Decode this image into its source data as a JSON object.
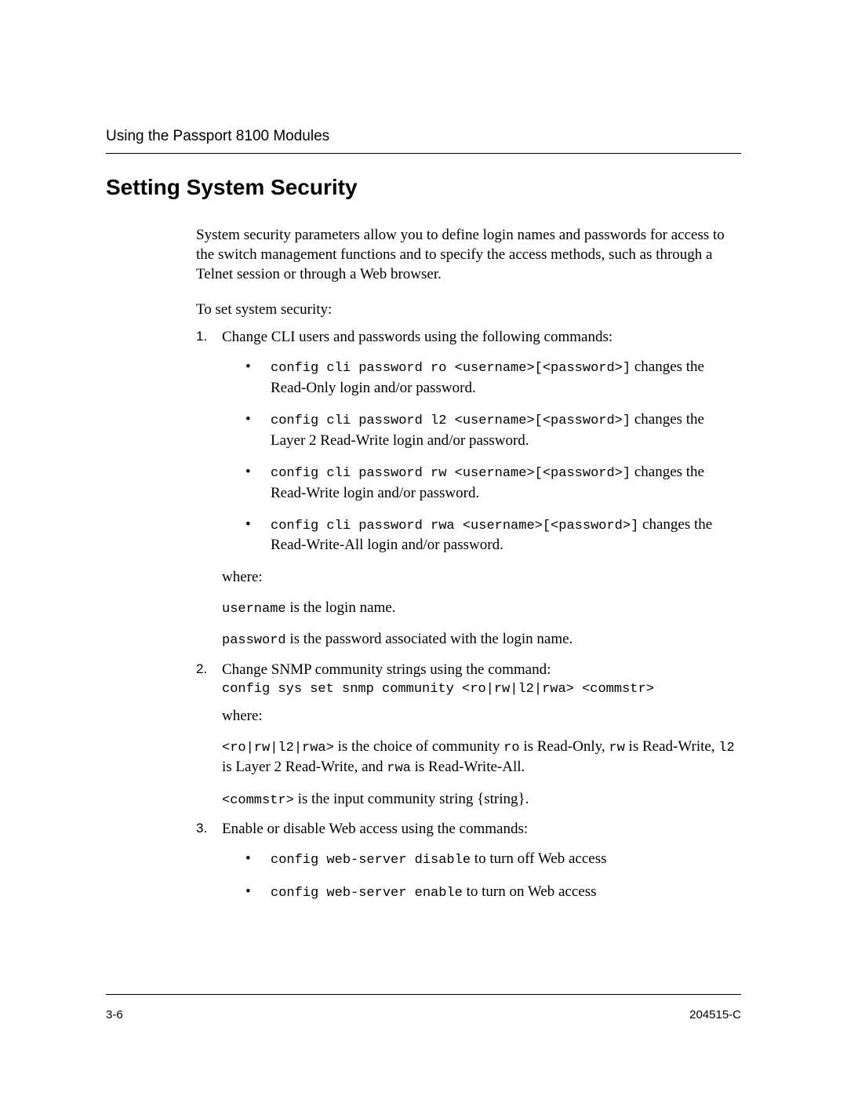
{
  "header": {
    "running_title": "Using the Passport 8100 Modules"
  },
  "title": "Setting System Security",
  "intro": "System security parameters allow you to define login names and passwords for access to the switch management functions and to specify the access methods, such as through a Telnet session or through a Web browser.",
  "lead": "To set system security:",
  "steps": [
    {
      "title": "Change CLI users and passwords using the following commands:",
      "bullets": [
        {
          "cmd": "config cli password ro <username>[<password>]",
          "desc_tail": " changes the Read-Only login and/or password."
        },
        {
          "cmd": "config cli password l2 <username>[<password>]",
          "desc_tail": " changes the Layer 2 Read-Write login and/or password."
        },
        {
          "cmd": "config cli password rw <username>[<password>]",
          "desc_tail": " changes the Read-Write login and/or password."
        },
        {
          "cmd": "config cli password rwa <username>[<password>]",
          "desc_tail": " changes the Read-Write-All login and/or password."
        }
      ],
      "where": "where:",
      "where_p1_code": "username",
      "where_p1_text": " is the login name.",
      "where_p2_code": "password",
      "where_p2_text": " is the password associated with the login name."
    },
    {
      "title": "Change SNMP community strings using the command:",
      "cmdline": "config sys set snmp community <ro|rw|l2|rwa> <commstr>",
      "where": "where:",
      "p1_c1": "<ro|rw|l2|rwa>",
      "p1_t1": " is the choice of community  ",
      "p1_c2": "ro",
      "p1_t2": " is Read-Only, ",
      "p1_c3": "rw",
      "p1_t3": " is Read-Write, ",
      "p1_c4": "l2",
      "p1_t4": " is Layer 2 Read-Write, and ",
      "p1_c5": "rwa",
      "p1_t5": " is Read-Write-All.",
      "p2_c1": "<commstr>",
      "p2_t1": " is the input community string {string}."
    },
    {
      "title": "Enable or disable Web access using the commands:",
      "bullets": [
        {
          "cmd": "config web-server disable",
          "desc_tail": " to turn off Web access"
        },
        {
          "cmd": "config web-server enable",
          "desc_tail": " to turn on Web access"
        }
      ]
    }
  ],
  "footer": {
    "page": "3-6",
    "docid": "204515-C"
  }
}
